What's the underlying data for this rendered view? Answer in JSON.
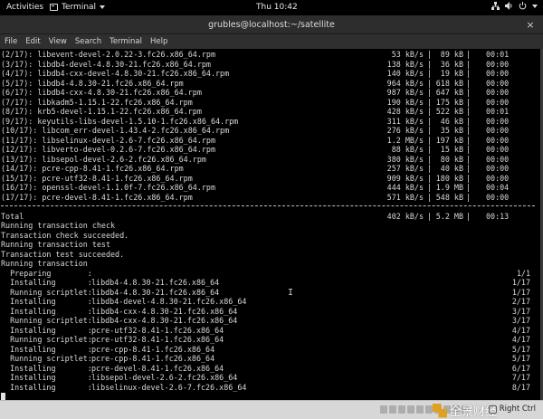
{
  "topbar": {
    "activities": "Activities",
    "app_name": "Terminal",
    "clock": "Thu 10:42",
    "icons": [
      "network-icon",
      "volume-icon",
      "power-icon",
      "menu-arrow-icon"
    ]
  },
  "window": {
    "title": "grubles@localhost:~/satellite",
    "close_symbol": "×"
  },
  "menu": [
    "File",
    "Edit",
    "View",
    "Search",
    "Terminal",
    "Help"
  ],
  "downloads": [
    {
      "name": "(2/17): libevent-devel-2.0.22-3.fc26.x86_64.rpm",
      "speed": "53 kB/s",
      "size": "89 kB",
      "time": "00:01"
    },
    {
      "name": "(3/17): libdb4-devel-4.8.30-21.fc26.x86_64.rpm",
      "speed": "138 kB/s",
      "size": "36 kB",
      "time": "00:00"
    },
    {
      "name": "(4/17): libdb4-cxx-devel-4.8.30-21.fc26.x86_64.rpm",
      "speed": "140 kB/s",
      "size": "19 kB",
      "time": "00:00"
    },
    {
      "name": "(5/17): libdb4-4.8.30-21.fc26.x86_64.rpm",
      "speed": "964 kB/s",
      "size": "618 kB",
      "time": "00:00"
    },
    {
      "name": "(6/17): libdb4-cxx-4.8.30-21.fc26.x86_64.rpm",
      "speed": "987 kB/s",
      "size": "647 kB",
      "time": "00:00"
    },
    {
      "name": "(7/17): libkadm5-1.15.1-22.fc26.x86_64.rpm",
      "speed": "190 kB/s",
      "size": "175 kB",
      "time": "00:00"
    },
    {
      "name": "(8/17): krb5-devel-1.15.1-22.fc26.x86_64.rpm",
      "speed": "428 kB/s",
      "size": "522 kB",
      "time": "00:01"
    },
    {
      "name": "(9/17): keyutils-libs-devel-1.5.10-1.fc26.x86_64.rpm",
      "speed": "311 kB/s",
      "size": "46 kB",
      "time": "00:00"
    },
    {
      "name": "(10/17): libcom_err-devel-1.43.4-2.fc26.x86_64.rpm",
      "speed": "276 kB/s",
      "size": "35 kB",
      "time": "00:00"
    },
    {
      "name": "(11/17): libselinux-devel-2.6-7.fc26.x86_64.rpm",
      "speed": "1.2 MB/s",
      "size": "197 kB",
      "time": "00:00"
    },
    {
      "name": "(12/17): libverto-devel-0.2.6-7.fc26.x86_64.rpm",
      "speed": "88 kB/s",
      "size": "15 kB",
      "time": "00:00"
    },
    {
      "name": "(13/17): libsepol-devel-2.6-2.fc26.x86_64.rpm",
      "speed": "380 kB/s",
      "size": "80 kB",
      "time": "00:00"
    },
    {
      "name": "(14/17): pcre-cpp-8.41-1.fc26.x86_64.rpm",
      "speed": "257 kB/s",
      "size": "40 kB",
      "time": "00:00"
    },
    {
      "name": "(15/17): pcre-utf32-8.41-1.fc26.x86_64.rpm",
      "speed": "909 kB/s",
      "size": "180 kB",
      "time": "00:00"
    },
    {
      "name": "(16/17): openssl-devel-1.1.0f-7.fc26.x86_64.rpm",
      "speed": "444 kB/s",
      "size": "1.9 MB",
      "time": "00:04"
    },
    {
      "name": "(17/17): pcre-devel-8.41-1.fc26.x86_64.rpm",
      "speed": "571 kB/s",
      "size": "548 kB",
      "time": "00:00"
    }
  ],
  "separator": "|",
  "total": {
    "label": "Total",
    "speed": "402 kB/s",
    "size": "5.2 MB",
    "time": "00:13"
  },
  "status_lines": [
    "Running transaction check",
    "Transaction check succeeded.",
    "Running transaction test",
    "Transaction test succeeded.",
    "Running transaction"
  ],
  "transactions": [
    {
      "action": "  Preparing        :",
      "pkg": "",
      "progress": "1/1"
    },
    {
      "action": "  Installing       :",
      "pkg": "libdb4-4.8.30-21.fc26.x86_64",
      "progress": "1/17"
    },
    {
      "action": "  Running scriptlet:",
      "pkg": "libdb4-4.8.30-21.fc26.x86_64",
      "progress": "1/17"
    },
    {
      "action": "  Installing       :",
      "pkg": "libdb4-devel-4.8.30-21.fc26.x86_64",
      "progress": "2/17"
    },
    {
      "action": "  Installing       :",
      "pkg": "libdb4-cxx-4.8.30-21.fc26.x86_64",
      "progress": "3/17"
    },
    {
      "action": "  Running scriptlet:",
      "pkg": "libdb4-cxx-4.8.30-21.fc26.x86_64",
      "progress": "3/17"
    },
    {
      "action": "  Installing       :",
      "pkg": "pcre-utf32-8.41-1.fc26.x86_64",
      "progress": "4/17"
    },
    {
      "action": "  Running scriptlet:",
      "pkg": "pcre-utf32-8.41-1.fc26.x86_64",
      "progress": "4/17"
    },
    {
      "action": "  Installing       :",
      "pkg": "pcre-cpp-8.41-1.fc26.x86_64",
      "progress": "5/17"
    },
    {
      "action": "  Running scriptlet:",
      "pkg": "pcre-cpp-8.41-1.fc26.x86_64",
      "progress": "5/17"
    },
    {
      "action": "  Installing       :",
      "pkg": "pcre-devel-8.41-1.fc26.x86_64",
      "progress": "6/17"
    },
    {
      "action": "  Installing       :",
      "pkg": "libsepol-devel-2.6-2.fc26.x86_64",
      "progress": "7/17"
    },
    {
      "action": "  Installing       :",
      "pkg": "libselinux-devel-2.6-7.fc26.x86_64",
      "progress": "8/17"
    }
  ],
  "statusbar": {
    "watermark": "全景财经",
    "host_key": "Right Ctrl"
  }
}
